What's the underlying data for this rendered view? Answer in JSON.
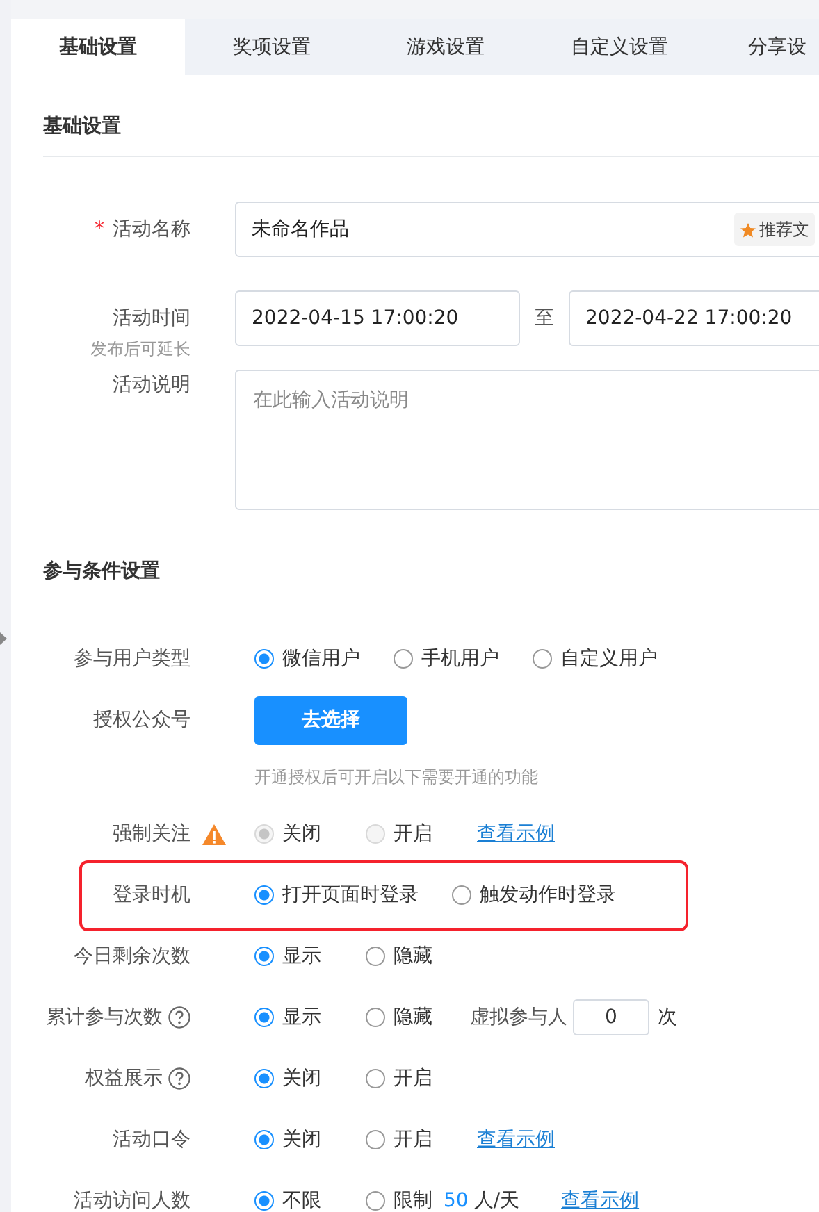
{
  "tabs": [
    {
      "label": "基础设置",
      "selected": true
    },
    {
      "label": "奖项设置",
      "selected": false
    },
    {
      "label": "游戏设置",
      "selected": false
    },
    {
      "label": "自定义设置",
      "selected": false
    },
    {
      "label": "分享设",
      "selected": false
    }
  ],
  "basic": {
    "title": "基础设置",
    "fields": [
      {
        "kind": "text",
        "label": "活动名称",
        "required_mark": "*",
        "value": "未命名作品",
        "badge": "推荐文"
      },
      {
        "kind": "daterange",
        "label": "活动时间",
        "hint": "发布后可延长",
        "start": "2022-04-15 17:00:20",
        "separator": "至",
        "end": "2022-04-22 17:00:20"
      },
      {
        "kind": "textarea",
        "label": "活动说明",
        "placeholder": "在此输入活动说明"
      }
    ]
  },
  "conditions": {
    "title": "参与条件设置",
    "rows": [
      {
        "kind": "radio",
        "label": "参与用户类型",
        "options": [
          {
            "label": "微信用户",
            "selected": true
          },
          {
            "label": "手机用户",
            "selected": false
          },
          {
            "label": "自定义用户",
            "selected": false
          }
        ]
      },
      {
        "kind": "button",
        "label": "授权公众号",
        "button": "去选择",
        "hint": "开通授权后可开启以下需要开通的功能"
      },
      {
        "kind": "radio",
        "label": "强制关注",
        "warning": true,
        "disabled": true,
        "options": [
          {
            "label": "关闭",
            "selected": true
          },
          {
            "label": "开启",
            "selected": false
          }
        ],
        "link": "查看示例"
      },
      {
        "kind": "radio",
        "label": "登录时机",
        "highlighted": true,
        "options": [
          {
            "label": "打开页面时登录",
            "selected": true
          },
          {
            "label": "触发动作时登录",
            "selected": false
          }
        ]
      },
      {
        "kind": "radio",
        "label": "今日剩余次数",
        "options": [
          {
            "label": "显示",
            "selected": true
          },
          {
            "label": "隐藏",
            "selected": false
          }
        ]
      },
      {
        "kind": "radio",
        "label": "累计参与次数",
        "help": true,
        "options": [
          {
            "label": "显示",
            "selected": true
          },
          {
            "label": "隐藏",
            "selected": false
          }
        ],
        "extra": {
          "label": "虚拟参与人",
          "value": "0",
          "unit": "次"
        }
      },
      {
        "kind": "radio",
        "label": "权益展示",
        "help": true,
        "options": [
          {
            "label": "关闭",
            "selected": true
          },
          {
            "label": "开启",
            "selected": false
          }
        ]
      },
      {
        "kind": "radio",
        "label": "活动口令",
        "options": [
          {
            "label": "关闭",
            "selected": true
          },
          {
            "label": "开启",
            "selected": false
          }
        ],
        "link": "查看示例"
      },
      {
        "kind": "radio",
        "label": "活动访问人数",
        "options": [
          {
            "label": "不限",
            "selected": true
          },
          {
            "label": "限制",
            "selected": false,
            "limit": {
              "value": "50",
              "unit": "人/天"
            }
          }
        ],
        "link": "查看示例"
      }
    ]
  }
}
